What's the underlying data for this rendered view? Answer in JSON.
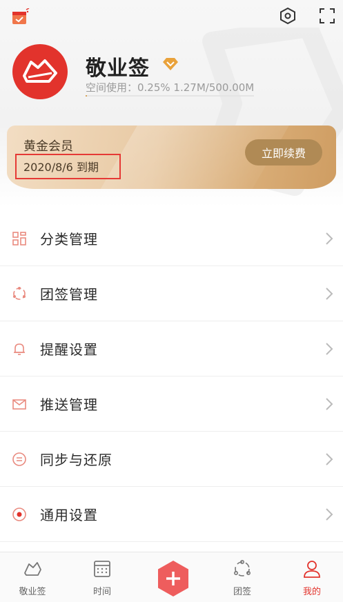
{
  "header": {
    "app_name": "敬业签",
    "storage_text": "空间使用：0.25%  1.27M/500.00M",
    "storage_percent": 0.25,
    "icons": [
      "calendar-check-icon",
      "settings-hex-icon",
      "fullscreen-icon",
      "vip-diamond-icon"
    ]
  },
  "member": {
    "title": "黄金会员",
    "expire": "2020/8/6 到期",
    "renew_label": "立即续费",
    "colors": {
      "card_start": "#f2ddc3",
      "card_end": "#cf9d62",
      "button": "#b08a55",
      "highlight": "#e53935"
    }
  },
  "menu": {
    "items": [
      {
        "label": "分类管理",
        "icon": "category-grid-icon"
      },
      {
        "label": "团签管理",
        "icon": "team-circle-icon"
      },
      {
        "label": "提醒设置",
        "icon": "bell-icon"
      },
      {
        "label": "推送管理",
        "icon": "envelope-icon"
      },
      {
        "label": "同步与还原",
        "icon": "sync-icon"
      },
      {
        "label": "通用设置",
        "icon": "general-settings-icon"
      }
    ]
  },
  "tabbar": {
    "tabs": [
      {
        "label": "敬业签",
        "icon": "note-logo-icon"
      },
      {
        "label": "时间",
        "icon": "calendar-grid-icon"
      },
      {
        "label": "",
        "icon": "add-icon"
      },
      {
        "label": "团签",
        "icon": "team-icon"
      },
      {
        "label": "我的",
        "icon": "person-icon",
        "active": true
      }
    ]
  },
  "colors": {
    "accent": "#e2332c",
    "gold": "#d6a35a"
  }
}
